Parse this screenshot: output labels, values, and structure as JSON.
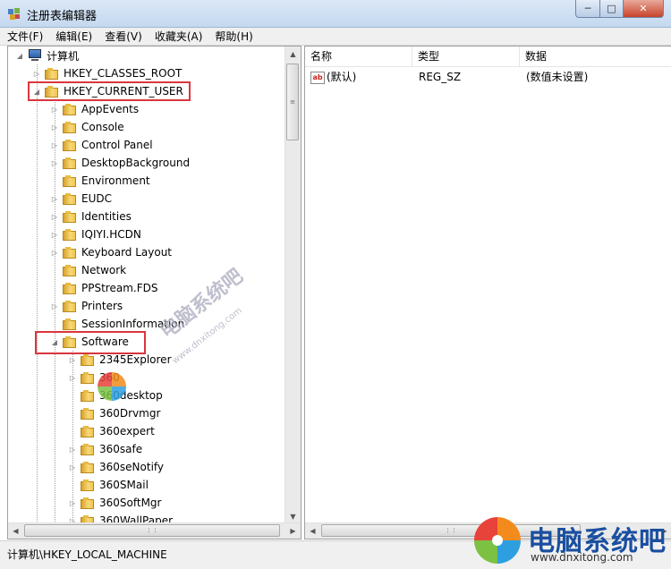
{
  "window": {
    "title": "注册表编辑器",
    "controls": {
      "minimize": "─",
      "maximize": "□",
      "close": "✕"
    }
  },
  "menu": [
    "文件(F)",
    "编辑(E)",
    "查看(V)",
    "收藏夹(A)",
    "帮助(H)"
  ],
  "tree": {
    "root": "计算机",
    "hives": [
      {
        "label": "HKEY_CLASSES_ROOT",
        "expanded": false
      },
      {
        "label": "HKEY_CURRENT_USER",
        "expanded": true,
        "highlighted": true
      }
    ],
    "current_user_children": [
      "AppEvents",
      "Console",
      "Control Panel",
      "DesktopBackground",
      "Environment",
      "EUDC",
      "Identities",
      "IQIYI.HCDN",
      "Keyboard Layout",
      "Network",
      "PPStream.FDS",
      "Printers",
      "SessionInformation",
      "Software"
    ],
    "software_children": [
      "2345Explorer",
      "360",
      "360desktop",
      "360Drvmgr",
      "360expert",
      "360safe",
      "360seNotify",
      "360SMail",
      "360SoftMgr",
      "360WallPaper"
    ]
  },
  "values_pane": {
    "columns": [
      "名称",
      "类型",
      "数据"
    ],
    "rows": [
      {
        "name": "(默认)",
        "type": "REG_SZ",
        "data": "(数值未设置)"
      }
    ]
  },
  "status": {
    "path": "计算机\\HKEY_LOCAL_MACHINE"
  },
  "watermark": {
    "brand": "电脑系统吧",
    "url": "www.dnxitong.com",
    "center_text": "电脑系统吧",
    "center_url": "www.dnxitong.com"
  },
  "colors": {
    "highlight_box": "#d9363e",
    "brand_blue": "#1a4fa0"
  }
}
